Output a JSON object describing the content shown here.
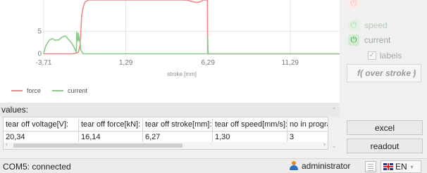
{
  "chart_data": {
    "type": "line",
    "xlabel": "stroke [mm]",
    "x_ticks": [
      "-3,71",
      "1,29",
      "6,29",
      "11,29"
    ],
    "y_ticks": [
      "0",
      "5"
    ],
    "xlim": [
      -3.71,
      14.3
    ],
    "ylim": [
      -0.4,
      12
    ],
    "grid": true,
    "legend_position": "bottom-left",
    "series": [
      {
        "name": "force",
        "color": "#f08a8a",
        "x": [
          -3.71,
          -1.9,
          -1.6,
          -1.5,
          -1.45,
          -1.4,
          -1.3,
          -1.2,
          -1.0,
          0.0,
          1.0,
          2.0,
          3.0,
          4.0,
          4.8,
          5.1,
          5.25,
          5.4,
          5.5,
          5.6,
          5.7,
          5.8,
          5.9,
          5.97,
          6.0,
          6.25,
          6.27,
          6.3,
          7.29,
          9.29,
          11.29,
          13.5,
          14.3
        ],
        "y": [
          0,
          0,
          0.3,
          1.8,
          5,
          8.5,
          10.5,
          11.5,
          12,
          12,
          12,
          12,
          12,
          12,
          12,
          11.9,
          11.7,
          11.6,
          11.5,
          11.45,
          11.5,
          11.6,
          11.75,
          11.95,
          12,
          12,
          0,
          0,
          0,
          0,
          0,
          0,
          0
        ]
      },
      {
        "name": "current",
        "color": "#8cc98c",
        "x": [
          -3.71,
          -3.6,
          -3.4,
          -3.2,
          -3.0,
          -2.8,
          -2.6,
          -2.4,
          -2.2,
          -2.0,
          -1.9,
          -1.8,
          -1.72,
          -1.7,
          -1.66,
          -1.62,
          -1.6,
          -1.55,
          -1.5,
          -1.45,
          -1.3,
          6.27,
          6.27,
          6.3,
          14.3
        ],
        "y": [
          0,
          1.6,
          2.9,
          3.4,
          3.0,
          3.1,
          3.7,
          4.0,
          3.2,
          2.4,
          1.7,
          1.0,
          0.3,
          4.8,
          3.5,
          2.8,
          4.6,
          3.2,
          2.7,
          0.8,
          0,
          0,
          3.6,
          0,
          0
        ]
      }
    ]
  },
  "right_panel": {
    "toggles": [
      {
        "label": "",
        "icon": "power-icon",
        "state": "faded-red"
      },
      {
        "label": "speed",
        "icon": "power-icon",
        "state": "dim-green"
      },
      {
        "label": "current",
        "icon": "power-icon",
        "state": "on-green"
      }
    ],
    "labels_checkbox": {
      "label": "labels",
      "checked": true
    },
    "function_select": "f( over stroke )",
    "excel_label": "excel",
    "readout_label": "readout"
  },
  "values_section": {
    "label": "values:",
    "columns": [
      "tear off voltage[V]:",
      "tear off force[kN]:",
      "tear off stroke[mm]:",
      "tear off speed[mm/s]:",
      "no in progra"
    ],
    "rows": [
      [
        "20,34",
        "16,14",
        "6,27",
        "1,30",
        "3"
      ]
    ]
  },
  "status_bar": {
    "connection": "COM5: connected",
    "user": "administrator",
    "language": "EN"
  },
  "colors": {
    "force": "#f08a8a",
    "current": "#8cc98c",
    "power_on": "#2e9a3a",
    "user_icon_head": "#e08a2a",
    "user_icon_body": "#2a6fc4"
  }
}
